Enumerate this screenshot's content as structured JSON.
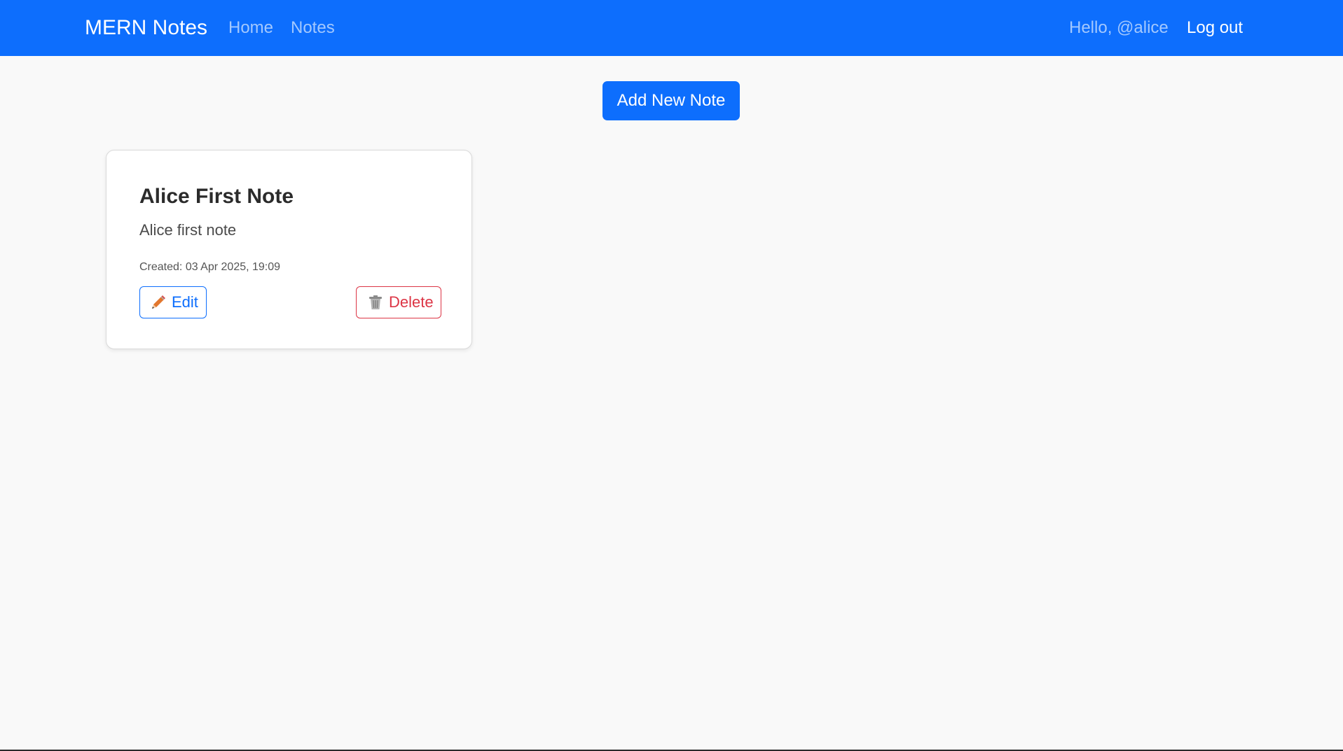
{
  "navbar": {
    "brand": "MERN Notes",
    "links": [
      {
        "label": "Home"
      },
      {
        "label": "Notes"
      }
    ],
    "greeting": "Hello, @alice",
    "logout_label": "Log out"
  },
  "actions": {
    "add_note_label": "Add New Note"
  },
  "notes": [
    {
      "title": "Alice First Note",
      "body": "Alice first note",
      "created": "Created: 03 Apr 2025, 19:09",
      "edit_label": "Edit",
      "edit_icon": "pencil-icon",
      "delete_label": "Delete",
      "delete_icon": "trash-icon"
    }
  ],
  "colors": {
    "primary": "#0d6efd",
    "danger": "#dc3545",
    "background": "#f9f9f9"
  }
}
